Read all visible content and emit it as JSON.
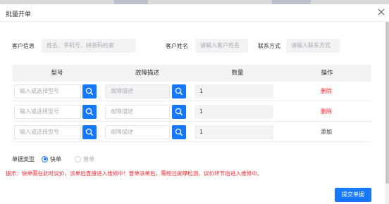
{
  "dialog": {
    "title": "批量开单"
  },
  "customer": {
    "info_label": "客户信息",
    "info_placeholder": "姓名、手机号、拼音码检索",
    "name_label": "客户姓名",
    "name_placeholder": "请输入客户姓名",
    "contact_label": "联系方式",
    "contact_placeholder": "请输入联系方式"
  },
  "table": {
    "headers": {
      "model": "型号",
      "fault": "故障描述",
      "quantity": "数量",
      "action": "操作"
    },
    "rows": [
      {
        "model_placeholder": "输入或选择型号",
        "fault_placeholder": "故障描述",
        "quantity": "1",
        "action": "删除"
      },
      {
        "model_placeholder": "输入或选择型号",
        "fault_placeholder": "故障描述",
        "quantity": "1",
        "action": "删除"
      },
      {
        "model_placeholder": "输入或选择型号",
        "fault_placeholder": "故障描述",
        "quantity": "1",
        "action": "添加"
      }
    ]
  },
  "order_type": {
    "label": "单据类型",
    "options": [
      {
        "label": "快单",
        "checked": true
      },
      {
        "label": "普单",
        "checked": false
      }
    ]
  },
  "tip": "提示：快单需在此时议价，派单后直接进入维修中！普单派单后，需经过故障检测、议价环节后进入维修中。",
  "submit_label": "提交单据",
  "colors": {
    "primary": "#1677ff",
    "danger": "#f5222d",
    "input_bg": "#f2f3f5"
  },
  "icons": {
    "close": "close-icon",
    "search": "search-icon"
  }
}
